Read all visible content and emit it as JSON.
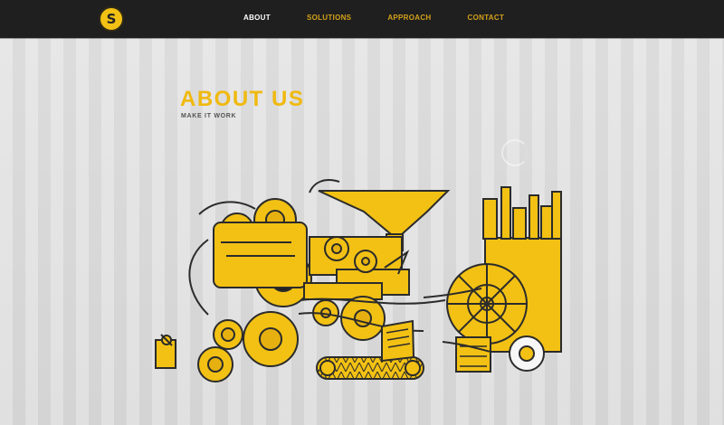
{
  "colors": {
    "accent": "#f0b90f",
    "nav_bg": "#1f1f1f",
    "page_bg": "#dcdcdc",
    "nav_text": "#d4a11a",
    "nav_active": "#ffffff"
  },
  "logo": {
    "letter": "S"
  },
  "nav": {
    "items": [
      {
        "label": "ABOUT"
      },
      {
        "label": "SOLUTIONS"
      },
      {
        "label": "APPROACH"
      },
      {
        "label": "CONTACT"
      }
    ]
  },
  "about": {
    "title": "ABOUT US",
    "subtitle": "MAKE IT WORK"
  },
  "illustration": {
    "icon": "machine-illustration"
  }
}
